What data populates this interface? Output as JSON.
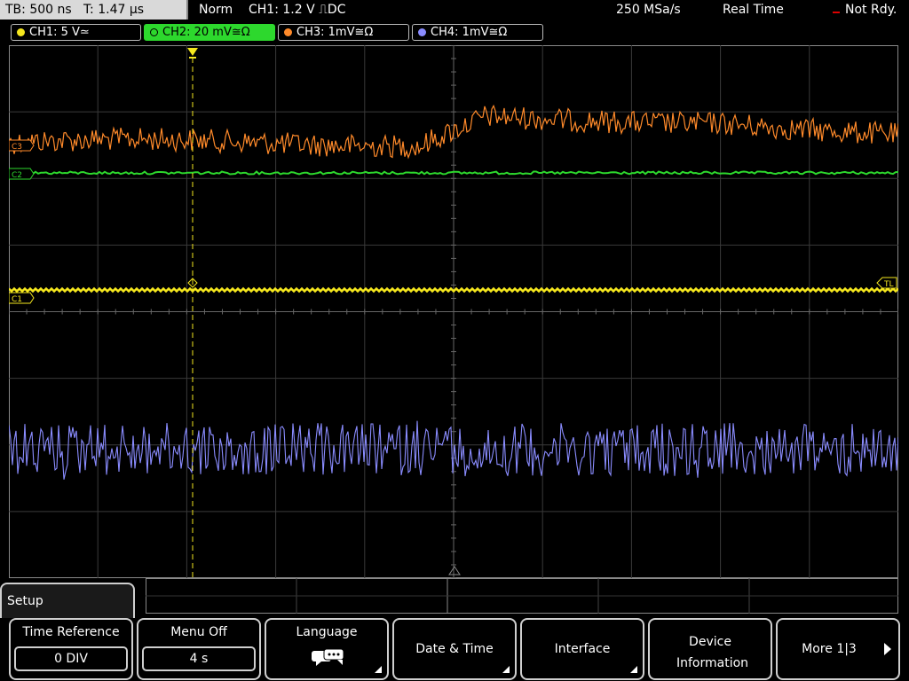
{
  "timebase": {
    "tb": "TB: 500 ns",
    "t": "T: 1.47 µs"
  },
  "status": {
    "mode": "Norm",
    "trigger": "CH1: 1.2 V ⎍DC",
    "sample_rate": "250 MSa/s",
    "acq": "Real Time",
    "state": "Not Rdy."
  },
  "channels": [
    {
      "label": "CH1: 5 V≃",
      "color": "#f5e71e"
    },
    {
      "label": "CH2: 20 mV≅Ω",
      "color": "#2dd82d"
    },
    {
      "label": "CH3: 1mV≅Ω",
      "color": "#ff8a2a"
    },
    {
      "label": "CH4: 1mV≅Ω",
      "color": "#8a8cff"
    }
  ],
  "markers": {
    "c3": "C3",
    "c2": "C2",
    "c1": "C1",
    "tl": "TL"
  },
  "menu": {
    "title": "Setup",
    "softkeys": [
      {
        "label": "Time Reference",
        "value": "0 DIV"
      },
      {
        "label": "Menu Off",
        "value": "4 s"
      },
      {
        "label": "Language"
      },
      {
        "label": "Date & Time"
      },
      {
        "label": "Interface"
      },
      {
        "label": "Device Information"
      },
      {
        "label": "More 1|3"
      }
    ]
  },
  "colors": {
    "grid": "#5a5a5a",
    "trace_ch1": "#f5e71e",
    "trace_ch2": "#2dd82d",
    "trace_ch3": "#ff8a2a",
    "trace_ch4": "#8a8cff"
  }
}
